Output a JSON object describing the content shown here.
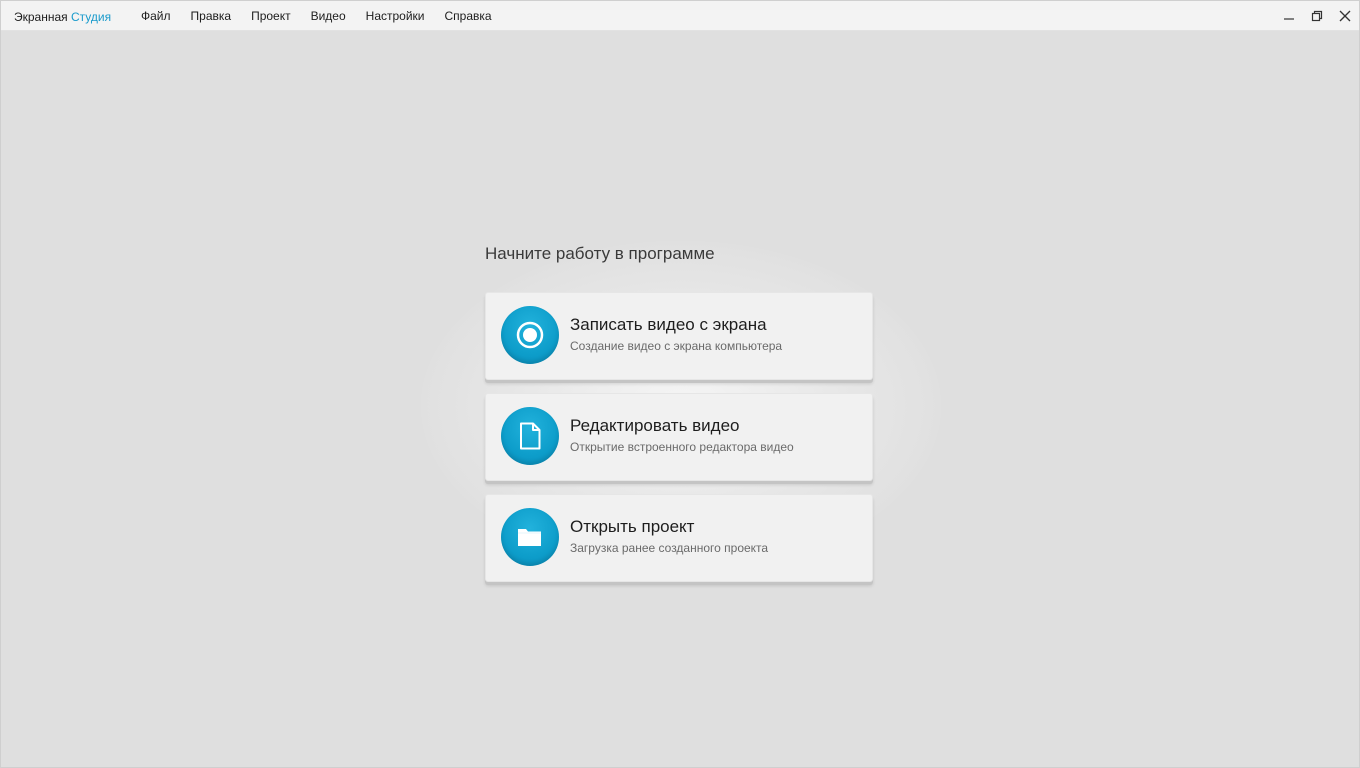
{
  "app": {
    "title_main": "Экранная",
    "title_accent": "Студия",
    "accent_color": "#1a9bcc"
  },
  "menu": [
    {
      "label": "Файл"
    },
    {
      "label": "Правка"
    },
    {
      "label": "Проект"
    },
    {
      "label": "Видео"
    },
    {
      "label": "Настройки"
    },
    {
      "label": "Справка"
    }
  ],
  "window_controls": {
    "minimize_icon": "minimize-icon",
    "restore_icon": "restore-icon",
    "close_icon": "close-icon"
  },
  "start": {
    "heading": "Начните работу в программе",
    "actions": [
      {
        "title": "Записать видео с экрана",
        "subtitle": "Создание видео с экрана компьютера",
        "icon": "record-icon"
      },
      {
        "title": "Редактировать видео",
        "subtitle": "Открытие встроенного редактора видео",
        "icon": "document-icon"
      },
      {
        "title": "Открыть проект",
        "subtitle": "Загрузка ранее созданного проекта",
        "icon": "folder-icon"
      }
    ]
  }
}
